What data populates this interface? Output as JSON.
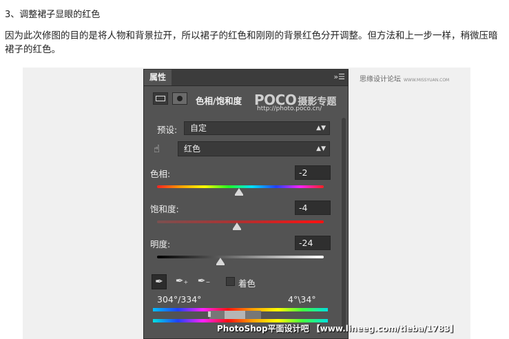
{
  "article": {
    "heading": "3、调整裙子显眼的红色",
    "paragraph": "因为此次修图的目的是将人物和背景拉开，所以裙子的红色和刚刚的背景红色分开调整。但方法和上一步一样，稍微压暗裙子的红色。"
  },
  "watermarks": {
    "site": "思缘设计论坛",
    "site_url": "WWW.MISSYUAN.COM",
    "poco_logo": "POCO",
    "poco_cn": "摄影专题",
    "poco_url": "http://photo.poco.cn/",
    "footer": "PhotoShop平面设计吧 【www.lineeg.com/tieba/1783】"
  },
  "panel": {
    "tab_title": "属性",
    "adjustment_title": "色相/饱和度",
    "preset_label": "预设:",
    "preset_value": "自定",
    "channel_value": "红色",
    "hue": {
      "label": "色相:",
      "value": "-2",
      "slider_fraction": 0.49
    },
    "saturation": {
      "label": "饱和度:",
      "value": "-4",
      "slider_fraction": 0.48
    },
    "lightness": {
      "label": "明度:",
      "value": "-24",
      "slider_fraction": 0.38
    },
    "colorize_label": "着色",
    "colorize_checked": false,
    "range_left": "304°/334°",
    "range_right": "4°\\34°",
    "icons": [
      "menu-icon",
      "levels-icon",
      "mask-icon",
      "hand-target-icon",
      "eyedropper-icon",
      "eyedropper-add-icon",
      "eyedropper-subtract-icon"
    ]
  }
}
